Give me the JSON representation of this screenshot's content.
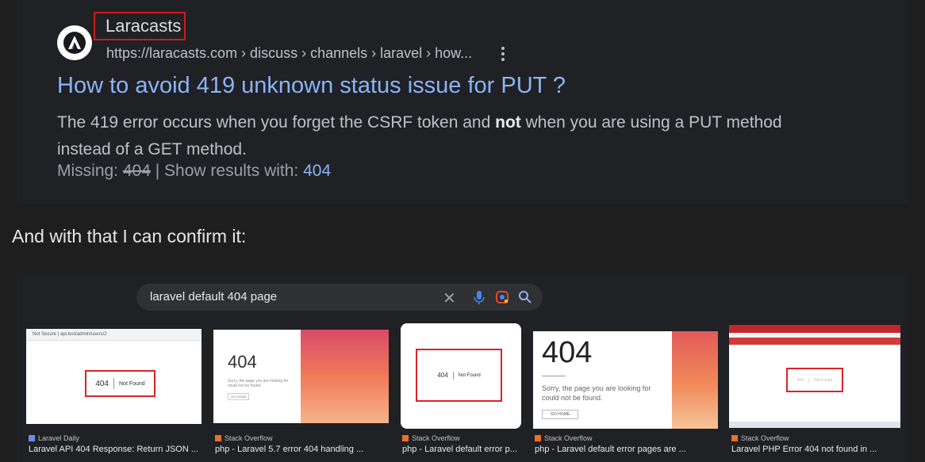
{
  "result": {
    "site_name": "Laracasts",
    "breadcrumb": "https://laracasts.com › discuss › channels › laravel › how...",
    "title": "How to avoid 419 unknown status issue for PUT ?",
    "snippet_before": "The 419 error occurs when you forget the CSRF token and ",
    "snippet_bold": "not",
    "snippet_after": " when you are using a PUT method instead of a GET method.",
    "missing_label": "Missing: ",
    "missing_term": "404",
    "show_results_label": " | Show results with: ",
    "show_results_term": "404"
  },
  "confirm_text": "And with that I can confirm it:",
  "image_search": {
    "query": "laravel default 404 page",
    "results": [
      {
        "source": "Laravel Daily",
        "caption": "Laravel API 404 Response: Return JSON ...",
        "code": "404",
        "message": "Not Found",
        "browser_bar": "Not Secure | api.test/admin/users/2"
      },
      {
        "source": "Stack Overflow",
        "caption": "php - Laravel 5.7 error 404 handling ...",
        "code": "404",
        "message": "Sorry, the page you are looking for could not be found.",
        "button": "GO HOME"
      },
      {
        "source": "Stack Overflow",
        "caption": "php - Laravel default error p...",
        "code": "404",
        "message": "Not Found"
      },
      {
        "source": "Stack Overflow",
        "caption": "php - Laravel default error pages are ...",
        "code": "404",
        "message": "Sorry, the page you are looking for could not be found.",
        "button": "GO HOME"
      },
      {
        "source": "Stack Overflow",
        "caption": "Laravel PHP Error 404 not found in ...",
        "code": "404",
        "message": "Not Found"
      }
    ]
  },
  "colors": {
    "link": "#8ab4f8",
    "highlight_box": "#d01a1a",
    "background": "#1e1e1e"
  }
}
